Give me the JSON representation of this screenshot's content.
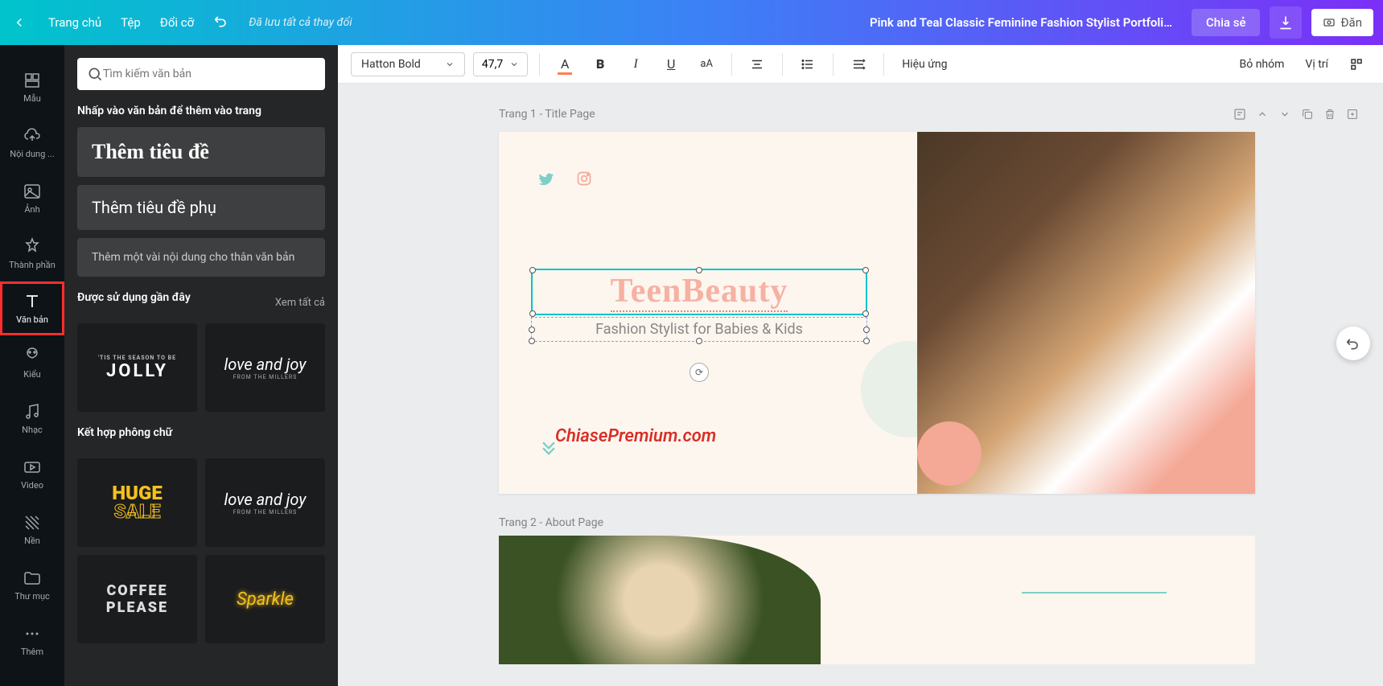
{
  "topbar": {
    "home": "Trang chủ",
    "file": "Tệp",
    "resize": "Đổi cỡ",
    "saved": "Đã lưu tất cả thay đổi",
    "title": "Pink and Teal Classic Feminine Fashion Stylist Portfolio Web...",
    "share": "Chia sẻ",
    "publish": "Đăn"
  },
  "rail": {
    "templates": "Mẫu",
    "uploads": "Nội dung ...",
    "photos": "Ảnh",
    "elements": "Thành phần",
    "text": "Văn bản",
    "styles": "Kiểu",
    "music": "Nhạc",
    "video": "Video",
    "background": "Nền",
    "folders": "Thư mục",
    "more": "Thêm"
  },
  "panel": {
    "search_ph": "Tìm kiếm văn bản",
    "click_hint": "Nhấp vào văn bản để thêm vào trang",
    "add_heading": "Thêm tiêu đề",
    "add_subhead": "Thêm tiêu đề phụ",
    "add_body": "Thêm một vài nội dung cho thân văn bản",
    "recent": "Được sử dụng gần đây",
    "see_all": "Xem tất cả",
    "font_combo": "Kết hợp phông chữ",
    "thumbs": {
      "jolly_top": "'TIS THE SEASON TO BE",
      "jolly": "JOLLY",
      "love": "love and joy",
      "love_sub": "FROM THE MILLERS",
      "huge1": "HUGE",
      "huge2": "SALE",
      "coffee1": "COFFEE",
      "coffee2": "PLEASE",
      "sparkle": "Sparkle"
    }
  },
  "toolbar": {
    "font": "Hatton Bold",
    "size": "47,7",
    "effects": "Hiệu ứng",
    "ungroup": "Bỏ nhóm",
    "position": "Vị trí"
  },
  "canvas": {
    "page1_label": "Trang 1 - Title Page",
    "page2_label": "Trang 2 - About Page",
    "title_text": "TeenBeauty",
    "sub_text": "Fashion Stylist for Babies & Kids"
  },
  "watermark": "ChiasePremium.com"
}
